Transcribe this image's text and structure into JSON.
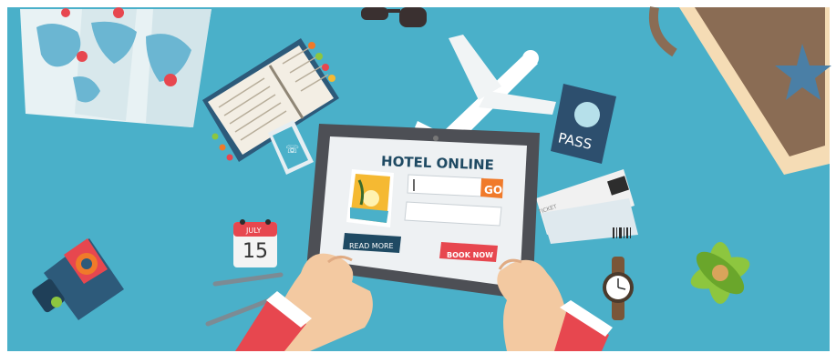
{
  "hotel": {
    "title": "HOTEL ONLINE",
    "go_label": "GO",
    "read_more_label": "READ MORE",
    "book_now_label": "BOOK NOW"
  },
  "passport": {
    "label": "PASS"
  },
  "calendar": {
    "month": "JULY",
    "day": "15"
  },
  "ticket": {
    "label": "TICKET"
  },
  "colors": {
    "background": "#4ab0c9",
    "accent_orange": "#f07a2a",
    "book_now_red": "#e7474f",
    "read_more_navy": "#1f4a63"
  }
}
